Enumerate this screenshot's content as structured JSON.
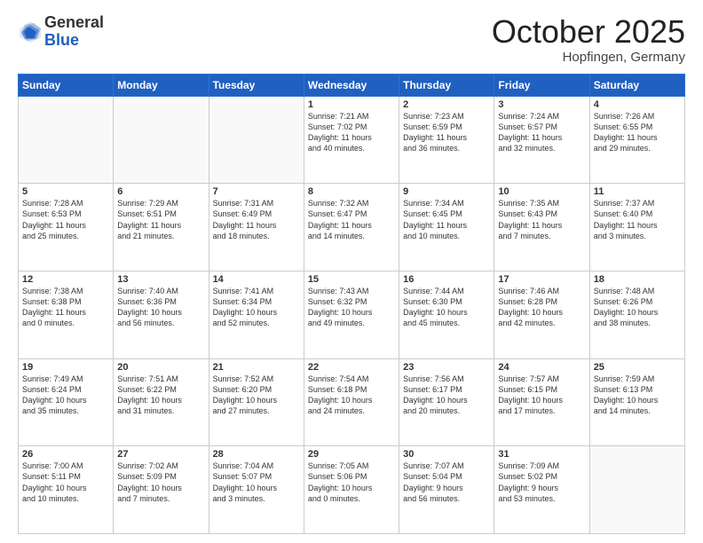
{
  "header": {
    "logo_general": "General",
    "logo_blue": "Blue",
    "month": "October 2025",
    "location": "Hopfingen, Germany"
  },
  "days_of_week": [
    "Sunday",
    "Monday",
    "Tuesday",
    "Wednesday",
    "Thursday",
    "Friday",
    "Saturday"
  ],
  "weeks": [
    [
      {
        "num": "",
        "info": ""
      },
      {
        "num": "",
        "info": ""
      },
      {
        "num": "",
        "info": ""
      },
      {
        "num": "1",
        "info": "Sunrise: 7:21 AM\nSunset: 7:02 PM\nDaylight: 11 hours\nand 40 minutes."
      },
      {
        "num": "2",
        "info": "Sunrise: 7:23 AM\nSunset: 6:59 PM\nDaylight: 11 hours\nand 36 minutes."
      },
      {
        "num": "3",
        "info": "Sunrise: 7:24 AM\nSunset: 6:57 PM\nDaylight: 11 hours\nand 32 minutes."
      },
      {
        "num": "4",
        "info": "Sunrise: 7:26 AM\nSunset: 6:55 PM\nDaylight: 11 hours\nand 29 minutes."
      }
    ],
    [
      {
        "num": "5",
        "info": "Sunrise: 7:28 AM\nSunset: 6:53 PM\nDaylight: 11 hours\nand 25 minutes."
      },
      {
        "num": "6",
        "info": "Sunrise: 7:29 AM\nSunset: 6:51 PM\nDaylight: 11 hours\nand 21 minutes."
      },
      {
        "num": "7",
        "info": "Sunrise: 7:31 AM\nSunset: 6:49 PM\nDaylight: 11 hours\nand 18 minutes."
      },
      {
        "num": "8",
        "info": "Sunrise: 7:32 AM\nSunset: 6:47 PM\nDaylight: 11 hours\nand 14 minutes."
      },
      {
        "num": "9",
        "info": "Sunrise: 7:34 AM\nSunset: 6:45 PM\nDaylight: 11 hours\nand 10 minutes."
      },
      {
        "num": "10",
        "info": "Sunrise: 7:35 AM\nSunset: 6:43 PM\nDaylight: 11 hours\nand 7 minutes."
      },
      {
        "num": "11",
        "info": "Sunrise: 7:37 AM\nSunset: 6:40 PM\nDaylight: 11 hours\nand 3 minutes."
      }
    ],
    [
      {
        "num": "12",
        "info": "Sunrise: 7:38 AM\nSunset: 6:38 PM\nDaylight: 11 hours\nand 0 minutes."
      },
      {
        "num": "13",
        "info": "Sunrise: 7:40 AM\nSunset: 6:36 PM\nDaylight: 10 hours\nand 56 minutes."
      },
      {
        "num": "14",
        "info": "Sunrise: 7:41 AM\nSunset: 6:34 PM\nDaylight: 10 hours\nand 52 minutes."
      },
      {
        "num": "15",
        "info": "Sunrise: 7:43 AM\nSunset: 6:32 PM\nDaylight: 10 hours\nand 49 minutes."
      },
      {
        "num": "16",
        "info": "Sunrise: 7:44 AM\nSunset: 6:30 PM\nDaylight: 10 hours\nand 45 minutes."
      },
      {
        "num": "17",
        "info": "Sunrise: 7:46 AM\nSunset: 6:28 PM\nDaylight: 10 hours\nand 42 minutes."
      },
      {
        "num": "18",
        "info": "Sunrise: 7:48 AM\nSunset: 6:26 PM\nDaylight: 10 hours\nand 38 minutes."
      }
    ],
    [
      {
        "num": "19",
        "info": "Sunrise: 7:49 AM\nSunset: 6:24 PM\nDaylight: 10 hours\nand 35 minutes."
      },
      {
        "num": "20",
        "info": "Sunrise: 7:51 AM\nSunset: 6:22 PM\nDaylight: 10 hours\nand 31 minutes."
      },
      {
        "num": "21",
        "info": "Sunrise: 7:52 AM\nSunset: 6:20 PM\nDaylight: 10 hours\nand 27 minutes."
      },
      {
        "num": "22",
        "info": "Sunrise: 7:54 AM\nSunset: 6:18 PM\nDaylight: 10 hours\nand 24 minutes."
      },
      {
        "num": "23",
        "info": "Sunrise: 7:56 AM\nSunset: 6:17 PM\nDaylight: 10 hours\nand 20 minutes."
      },
      {
        "num": "24",
        "info": "Sunrise: 7:57 AM\nSunset: 6:15 PM\nDaylight: 10 hours\nand 17 minutes."
      },
      {
        "num": "25",
        "info": "Sunrise: 7:59 AM\nSunset: 6:13 PM\nDaylight: 10 hours\nand 14 minutes."
      }
    ],
    [
      {
        "num": "26",
        "info": "Sunrise: 7:00 AM\nSunset: 5:11 PM\nDaylight: 10 hours\nand 10 minutes."
      },
      {
        "num": "27",
        "info": "Sunrise: 7:02 AM\nSunset: 5:09 PM\nDaylight: 10 hours\nand 7 minutes."
      },
      {
        "num": "28",
        "info": "Sunrise: 7:04 AM\nSunset: 5:07 PM\nDaylight: 10 hours\nand 3 minutes."
      },
      {
        "num": "29",
        "info": "Sunrise: 7:05 AM\nSunset: 5:06 PM\nDaylight: 10 hours\nand 0 minutes."
      },
      {
        "num": "30",
        "info": "Sunrise: 7:07 AM\nSunset: 5:04 PM\nDaylight: 9 hours\nand 56 minutes."
      },
      {
        "num": "31",
        "info": "Sunrise: 7:09 AM\nSunset: 5:02 PM\nDaylight: 9 hours\nand 53 minutes."
      },
      {
        "num": "",
        "info": ""
      }
    ]
  ]
}
